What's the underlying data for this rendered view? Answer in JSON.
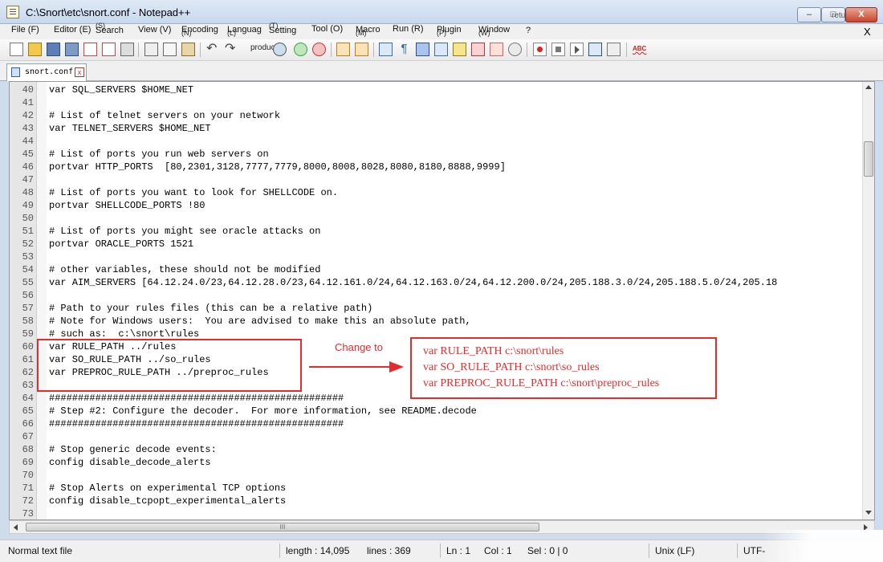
{
  "window": {
    "title": "C:\\Snort\\etc\\snort.conf - Notepad++",
    "overlay_label": "retu",
    "close_label": "X"
  },
  "menu": {
    "items": [
      "File (F)",
      "Editor (E)",
      "Search",
      "View (V)",
      "Encoding",
      "Languag",
      "Setting",
      "Tool (O)",
      "Macro",
      "Run (R)",
      "Plugin",
      "Window",
      "?"
    ],
    "mnemonics": [
      "(S)",
      "(N)",
      "(L)",
      "(T)",
      "(M)",
      "(P)",
      "(W)"
    ],
    "close_doc": "X"
  },
  "toolbar": {
    "product_label": "product",
    "icons": [
      "new-file-icon",
      "open-file-icon",
      "save-icon",
      "save-all-icon",
      "close-icon",
      "close-all-icon",
      "print-icon",
      "cut-icon",
      "copy-icon",
      "paste-icon",
      "undo-icon",
      "redo-icon",
      "find-icon",
      "replace-icon",
      "zoom-in-icon",
      "zoom-out-icon",
      "sync-v-icon",
      "sync-h-icon",
      "wrap-icon",
      "all-chars-icon",
      "indent-guide-icon",
      "doc-map-icon",
      "function-list-icon",
      "folder-workspace-icon",
      "monitor-icon",
      "record-macro-icon",
      "stop-macro-icon",
      "play-macro-icon",
      "run-multiple-macro-icon",
      "save-macro-icon",
      "spellcheck-icon"
    ],
    "spellcheck_text": "ABC"
  },
  "tab": {
    "label": "snort.conf",
    "close": "x"
  },
  "editor": {
    "lines": [
      {
        "n": "40",
        "text": "var SQL_SERVERS $HOME_NET"
      },
      {
        "n": "41",
        "text": ""
      },
      {
        "n": "42",
        "text": "# List of telnet servers on your network"
      },
      {
        "n": "43",
        "text": "var TELNET_SERVERS $HOME_NET"
      },
      {
        "n": "44",
        "text": ""
      },
      {
        "n": "45",
        "text": "# List of ports you run web servers on"
      },
      {
        "n": "46",
        "text": "portvar HTTP_PORTS  [80,2301,3128,7777,7779,8000,8008,8028,8080,8180,8888,9999]"
      },
      {
        "n": "47",
        "text": ""
      },
      {
        "n": "48",
        "text": "# List of ports you want to look for SHELLCODE on."
      },
      {
        "n": "49",
        "text": "portvar SHELLCODE_PORTS !80"
      },
      {
        "n": "50",
        "text": ""
      },
      {
        "n": "51",
        "text": "# List of ports you might see oracle attacks on"
      },
      {
        "n": "52",
        "text": "portvar ORACLE_PORTS 1521"
      },
      {
        "n": "53",
        "text": ""
      },
      {
        "n": "54",
        "text": "# other variables, these should not be modified"
      },
      {
        "n": "55",
        "text": "var AIM_SERVERS [64.12.24.0/23,64.12.28.0/23,64.12.161.0/24,64.12.163.0/24,64.12.200.0/24,205.188.3.0/24,205.188.5.0/24,205.18"
      },
      {
        "n": "56",
        "text": ""
      },
      {
        "n": "57",
        "text": "# Path to your rules files (this can be a relative path)"
      },
      {
        "n": "58",
        "text": "# Note for Windows users:  You are advised to make this an absolute path,"
      },
      {
        "n": "59",
        "text": "# such as:  c:\\snort\\rules"
      },
      {
        "n": "60",
        "text": "var RULE_PATH ../rules"
      },
      {
        "n": "61",
        "text": "var SO_RULE_PATH ../so_rules"
      },
      {
        "n": "62",
        "text": "var PREPROC_RULE_PATH ../preproc_rules"
      },
      {
        "n": "63",
        "text": ""
      },
      {
        "n": "64",
        "text": "###################################################"
      },
      {
        "n": "65",
        "text": "# Step #2: Configure the decoder.  For more information, see README.decode"
      },
      {
        "n": "66",
        "text": "###################################################"
      },
      {
        "n": "67",
        "text": ""
      },
      {
        "n": "68",
        "text": "# Stop generic decode events:"
      },
      {
        "n": "69",
        "text": "config disable_decode_alerts"
      },
      {
        "n": "70",
        "text": ""
      },
      {
        "n": "71",
        "text": "# Stop Alerts on experimental TCP options"
      },
      {
        "n": "72",
        "text": "config disable_tcpopt_experimental_alerts"
      },
      {
        "n": "73",
        "text": ""
      }
    ]
  },
  "annotation": {
    "change_label": "Change to",
    "new_lines": [
      "var RULE_PATH c:\\snort\\rules",
      "var SO_RULE_PATH c:\\snort\\so_rules",
      "var PREPROC_RULE_PATH c:\\snort\\preproc_rules"
    ],
    "color": "#e52b2b"
  },
  "hscroll": {
    "thumb_grip": "III"
  },
  "status": {
    "file_type": "Normal text file",
    "length": "length : 14,095",
    "lines": "lines : 369",
    "ln": "Ln : 1",
    "col": "Col : 1",
    "sel": "Sel : 0 | 0",
    "eol": "Unix (LF)",
    "encoding": "UTF-"
  }
}
